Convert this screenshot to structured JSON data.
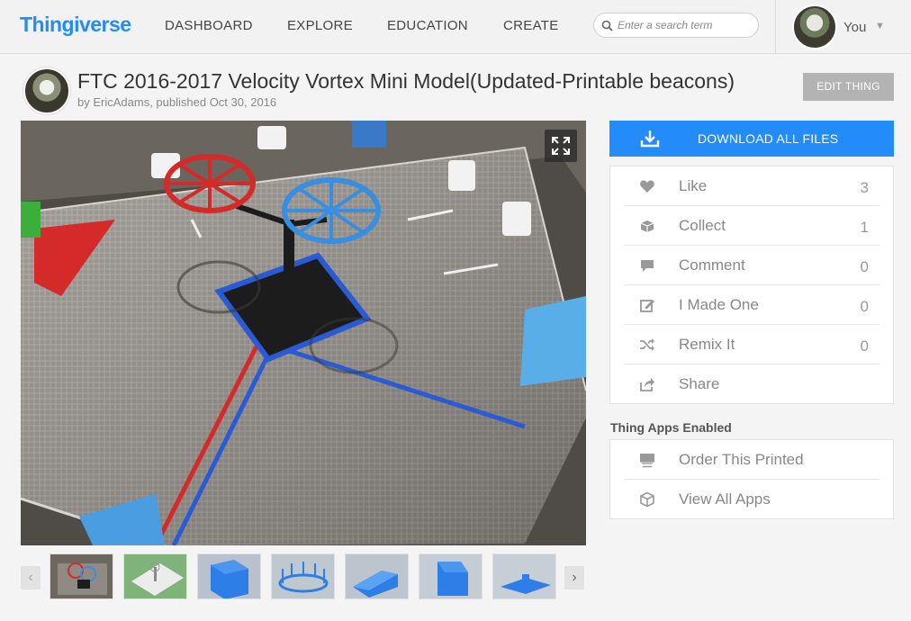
{
  "header": {
    "logo": "Thingiverse",
    "nav": [
      "DASHBOARD",
      "EXPLORE",
      "EDUCATION",
      "CREATE"
    ],
    "search_placeholder": "Enter a search term",
    "user_name": "You"
  },
  "thing": {
    "title": "FTC 2016-2017 Velocity Vortex Mini Model(Updated-Printable beacons)",
    "byline_prefix": "by ",
    "author": "EricAdams",
    "published": ", published Oct 30, 2016",
    "edit_label": "EDIT THING"
  },
  "sidebar": {
    "download_label": "DOWNLOAD ALL FILES",
    "actions": [
      {
        "label": "Like",
        "count": "3",
        "icon": "heart-icon"
      },
      {
        "label": "Collect",
        "count": "1",
        "icon": "collect-icon"
      },
      {
        "label": "Comment",
        "count": "0",
        "icon": "comment-icon"
      },
      {
        "label": "I Made One",
        "count": "0",
        "icon": "made-one-icon"
      },
      {
        "label": "Remix It",
        "count": "0",
        "icon": "remix-icon"
      },
      {
        "label": "Share",
        "count": "",
        "icon": "share-icon"
      }
    ],
    "apps_title": "Thing Apps Enabled",
    "apps": [
      {
        "label": "Order This Printed",
        "icon": "print-order-icon"
      },
      {
        "label": "View All Apps",
        "icon": "cube-icon"
      }
    ]
  },
  "gallery": {
    "thumbnail_count": 7,
    "prev_arrow": "‹",
    "next_arrow": "›"
  },
  "colors": {
    "brand_blue": "#248bfb",
    "edit_button_gray": "#b3b3b3"
  }
}
